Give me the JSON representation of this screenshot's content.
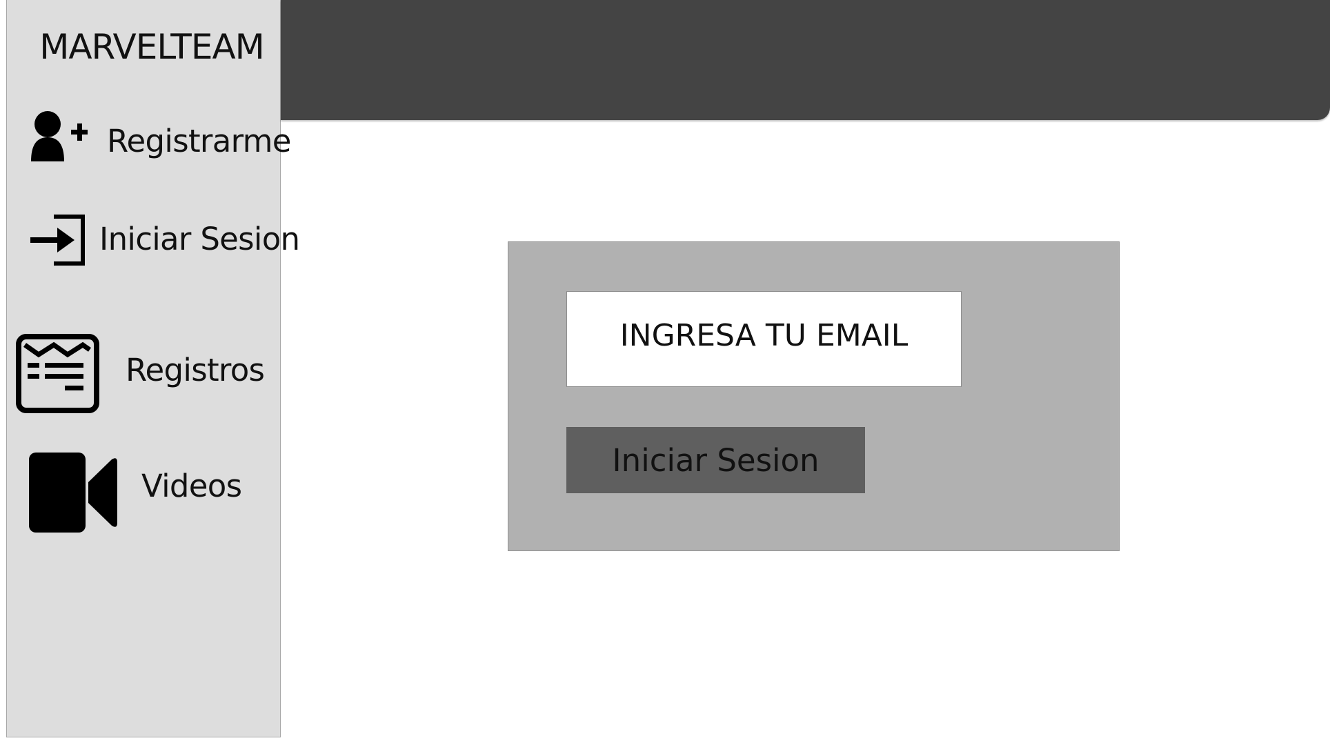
{
  "app": {
    "title": "MARVELTEAM"
  },
  "sidebar": {
    "items": [
      {
        "label": "Registrarme",
        "icon": "user-plus-icon"
      },
      {
        "label": "Iniciar Sesion",
        "icon": "sign-in-icon"
      },
      {
        "label": "Registros",
        "icon": "registry-list-icon"
      },
      {
        "label": "Videos",
        "icon": "video-camera-icon"
      }
    ]
  },
  "login": {
    "email_placeholder": "INGRESA TU EMAIL",
    "submit_label": "Iniciar Sesion"
  },
  "colors": {
    "topbar": "#444444",
    "sidebar": "#dddddd",
    "panel": "#b1b1b1",
    "button": "#5f5f5f",
    "icon": "#000000"
  }
}
